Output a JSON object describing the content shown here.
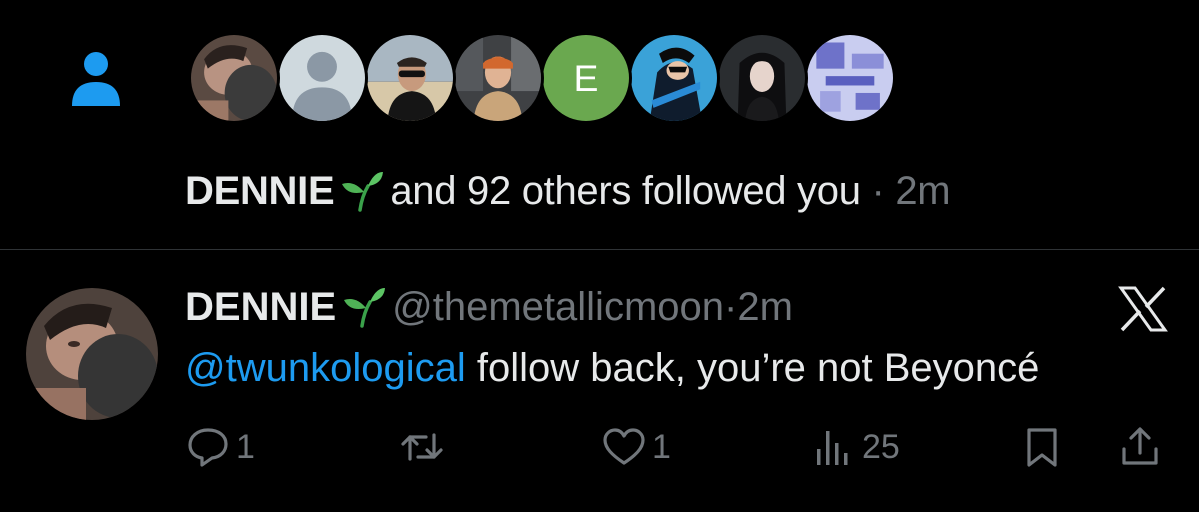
{
  "notification": {
    "name": "DENNIE",
    "emoji": "sprout-emoji",
    "text": "and 92 others followed you",
    "separator": "·",
    "time": "2m",
    "avatars": [
      {
        "type": "photo",
        "desc": "person-lying-dark"
      },
      {
        "type": "default"
      },
      {
        "type": "photo",
        "desc": "man-sunglasses-beach"
      },
      {
        "type": "photo",
        "desc": "red-hair-street"
      },
      {
        "type": "letter",
        "letter": "E",
        "color": "#6aa84f"
      },
      {
        "type": "photo",
        "desc": "cartoon-hero-blue"
      },
      {
        "type": "photo",
        "desc": "dark-hair-woman"
      },
      {
        "type": "photo",
        "desc": "blue-pattern"
      }
    ]
  },
  "tweet": {
    "display_name": "DENNIE",
    "handle": "@themetallicmoon",
    "separator": "·",
    "time": "2m",
    "mention": "@twunkological",
    "body": " follow back, you’re not Beyoncé",
    "actions": {
      "replies": "1",
      "reposts": "",
      "likes": "1",
      "views": "25"
    }
  },
  "colors": {
    "background": "#000000",
    "text": "#e7e9ea",
    "muted": "#71767b",
    "accent": "#1d9bf0",
    "divider": "#2f3336"
  },
  "icons": [
    "person-icon",
    "sprout-emoji",
    "x-logo-icon",
    "reply-icon",
    "repost-icon",
    "like-icon",
    "views-icon",
    "bookmark-icon",
    "share-icon"
  ]
}
